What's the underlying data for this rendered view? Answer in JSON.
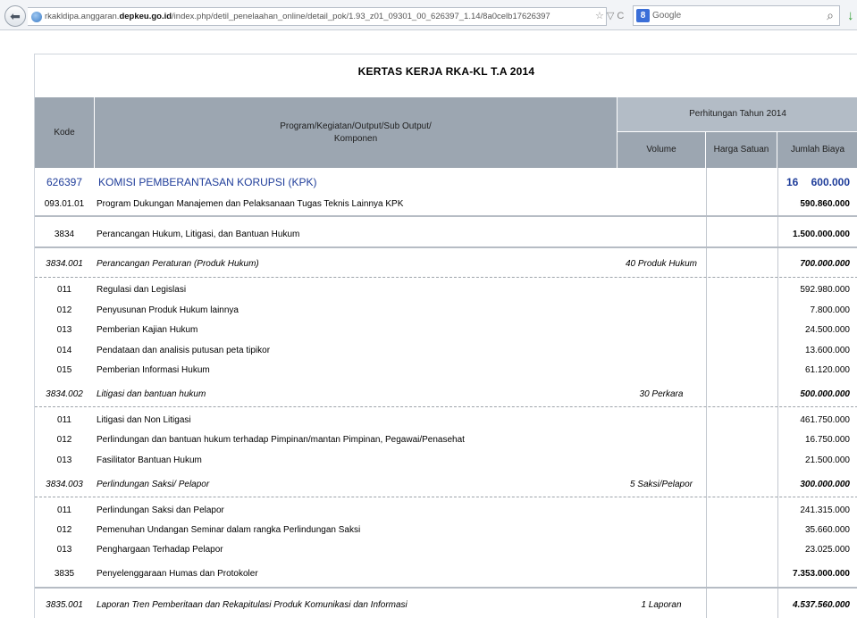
{
  "browser": {
    "url_prefix": "rkakldipa.anggaran.",
    "url_domain": "depkeu.go.id",
    "url_path": "/index.php/detil_penelaahan_online/detail_pok/1.93_z01_09301_00_626397_1.14/8a0celb17626397",
    "search_engine_label": "Google",
    "search_engine_badge": "8",
    "tools": "☆ ▽ C",
    "back_glyph": "⬅",
    "search_glyph": "⌕",
    "download_glyph": "↓"
  },
  "page": {
    "title": "KERTAS KERJA RKA-KL T.A 2014"
  },
  "table": {
    "headers": {
      "kode": "Kode",
      "program_line1": "Program/Kegiatan/Output/Sub Output/",
      "program_line2": "Komponen",
      "perhitungan": "Perhitungan Tahun 2014",
      "volume": "Volume",
      "harga_satuan": "Harga Satuan",
      "jumlah_biaya": "Jumlah Biaya"
    },
    "rows": [
      {
        "kode": "626397",
        "desc": "KOMISI PEMBERANTASAN KORUPSI (KPK)",
        "volume": "",
        "jumlah_prefix": "16",
        "jumlah": "600.000",
        "style": "kpk"
      },
      {
        "kode": "093.01.01",
        "desc": "Program Dukungan Manajemen dan Pelaksanaan Tugas Teknis Lainnya KPK",
        "volume": "",
        "jumlah": "590.860.000",
        "style": "program"
      },
      {
        "kode": "3834",
        "desc": "Perancangan Hukum, Litigasi, dan Bantuan Hukum",
        "volume": "",
        "jumlah": "1.500.000.000",
        "style": "kegiatan"
      },
      {
        "kode": "3834.001",
        "desc": "Perancangan Peraturan (Produk Hukum)",
        "volume": "40 Produk Hukum",
        "jumlah": "700.000.000",
        "style": "output"
      },
      {
        "kode": "011",
        "desc": "Regulasi dan Legislasi",
        "volume": "",
        "jumlah": "592.980.000",
        "style": "komponen"
      },
      {
        "kode": "012",
        "desc": "Penyusunan Produk Hukum lainnya",
        "volume": "",
        "jumlah": "7.800.000",
        "style": "komponen"
      },
      {
        "kode": "013",
        "desc": "Pemberian Kajian Hukum",
        "volume": "",
        "jumlah": "24.500.000",
        "style": "komponen"
      },
      {
        "kode": "014",
        "desc": "Pendataan dan analisis putusan peta tipikor",
        "volume": "",
        "jumlah": "13.600.000",
        "style": "komponen"
      },
      {
        "kode": "015",
        "desc": "Pemberian Informasi Hukum",
        "volume": "",
        "jumlah": "61.120.000",
        "style": "komponen"
      },
      {
        "kode": "3834.002",
        "desc": "Litigasi dan bantuan hukum",
        "volume": "30 Perkara",
        "jumlah": "500.000.000",
        "style": "output"
      },
      {
        "kode": "011",
        "desc": "Litigasi dan Non Litigasi",
        "volume": "",
        "jumlah": "461.750.000",
        "style": "komponen"
      },
      {
        "kode": "012",
        "desc": "Perlindungan dan bantuan hukum terhadap Pimpinan/mantan Pimpinan, Pegawai/Penasehat",
        "volume": "",
        "jumlah": "16.750.000",
        "style": "komponen"
      },
      {
        "kode": "013",
        "desc": "Fasilitator Bantuan Hukum",
        "volume": "",
        "jumlah": "21.500.000",
        "style": "komponen"
      },
      {
        "kode": "3834.003",
        "desc": "Perlindungan Saksi/ Pelapor",
        "volume": "5 Saksi/Pelapor",
        "jumlah": "300.000.000",
        "style": "output"
      },
      {
        "kode": "011",
        "desc": "Perlindungan Saksi dan Pelapor",
        "volume": "",
        "jumlah": "241.315.000",
        "style": "komponen"
      },
      {
        "kode": "012",
        "desc": "Pemenuhan Undangan Seminar dalam rangka Perlindungan Saksi",
        "volume": "",
        "jumlah": "35.660.000",
        "style": "komponen"
      },
      {
        "kode": "013",
        "desc": "Penghargaan Terhadap Pelapor",
        "volume": "",
        "jumlah": "23.025.000",
        "style": "komponen"
      },
      {
        "kode": "3835",
        "desc": "Penyelenggaraan Humas dan Protokoler",
        "volume": "",
        "jumlah": "7.353.000.000",
        "style": "kegiatan"
      },
      {
        "kode": "3835.001",
        "desc": "Laporan Tren Pemberitaan dan Rekapitulasi Produk Komunikasi dan Informasi",
        "volume": "1 Laporan",
        "jumlah": "4.537.560.000",
        "style": "output"
      }
    ]
  },
  "colors": {
    "header_bg": "#9ca6b1",
    "header_light_bg": "#b3bcc6",
    "kpk_text": "#1f3d9a"
  }
}
